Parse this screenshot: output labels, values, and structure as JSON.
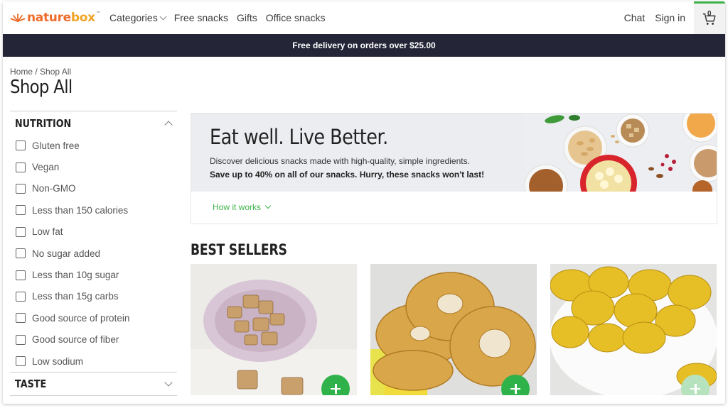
{
  "brand": {
    "logo_part1": "nature",
    "logo_part2": "box",
    "trademark": "™",
    "orange": "#ef6b2a",
    "yellow": "#f0a324"
  },
  "nav": {
    "categories": "Categories",
    "free_snacks": "Free snacks",
    "gifts": "Gifts",
    "office_snacks": "Office snacks",
    "chat": "Chat",
    "sign_in": "Sign in",
    "cart_count": "0"
  },
  "promo_banner": "Free delivery on orders over $25.00",
  "breadcrumb": {
    "home": "Home",
    "separator": "/",
    "current": "Shop All"
  },
  "page_title": "Shop All",
  "sidebar": {
    "nutrition_label": "NUTRITION",
    "filters": [
      "Gluten free",
      "Vegan",
      "Non-GMO",
      "Less than 150 calories",
      "Low fat",
      "No sugar added",
      "Less than 10g sugar",
      "Less than 15g carbs",
      "Good source of protein",
      "Good source of fiber",
      "Low sodium"
    ],
    "taste_label": "TASTE"
  },
  "hero": {
    "title": "Eat well. Live Better.",
    "subtitle": "Discover delicious snacks made with high-quality, simple ingredients.",
    "promo": "Save up to 40% on all of our snacks. Hurry, these snacks won't last!",
    "how_it_works": "How it works"
  },
  "best_sellers": {
    "heading": "BEST SELLERS",
    "products": [
      {
        "image": "granola-bites-on-pink-plate"
      },
      {
        "image": "dried-pineapple-rings"
      },
      {
        "image": "banana-chips-in-white-bowl"
      }
    ]
  },
  "colors": {
    "accent_green": "#2fb24a",
    "promo_bg": "#242536",
    "link_green": "#3db34a"
  }
}
